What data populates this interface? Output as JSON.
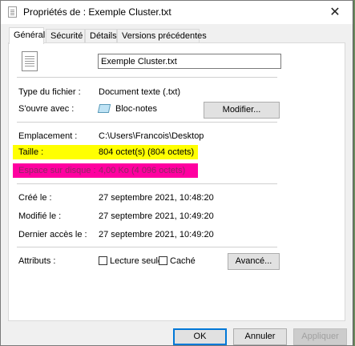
{
  "window": {
    "title": "Propriétés de : Exemple Cluster.txt",
    "close_glyph": "✕"
  },
  "tabs": [
    "Général",
    "Sécurité",
    "Détails",
    "Versions précédentes"
  ],
  "file": {
    "name": "Exemple Cluster.txt"
  },
  "props": {
    "type_label": "Type du fichier :",
    "type_value": "Document texte (.txt)",
    "opens_label": "S'ouvre avec :",
    "opens_value": "Bloc-notes",
    "change_button": "Modifier...",
    "location_label": "Emplacement :",
    "location_value": "C:\\Users\\Francois\\Desktop",
    "size_label": "Taille :",
    "size_value": "804 octet(s) (804 octets)",
    "disk_label": "Espace sur disque :",
    "disk_value": "4,00 Ko (4 096 octets)",
    "created_label": "Créé le :",
    "created_value": "27 septembre 2021, 10:48:20",
    "modified_label": "Modifié le :",
    "modified_value": "27 septembre 2021, 10:49:20",
    "accessed_label": "Dernier accès le :",
    "accessed_value": "27 septembre 2021, 10:49:20",
    "attributes_label": "Attributs :",
    "readonly_label": "Lecture seule",
    "hidden_label": "Caché",
    "advanced_button": "Avancé..."
  },
  "highlights": {
    "size_color": "#ffff00",
    "disk_color": "#ff00a0"
  },
  "footer": {
    "ok": "OK",
    "cancel": "Annuler",
    "apply": "Appliquer"
  }
}
